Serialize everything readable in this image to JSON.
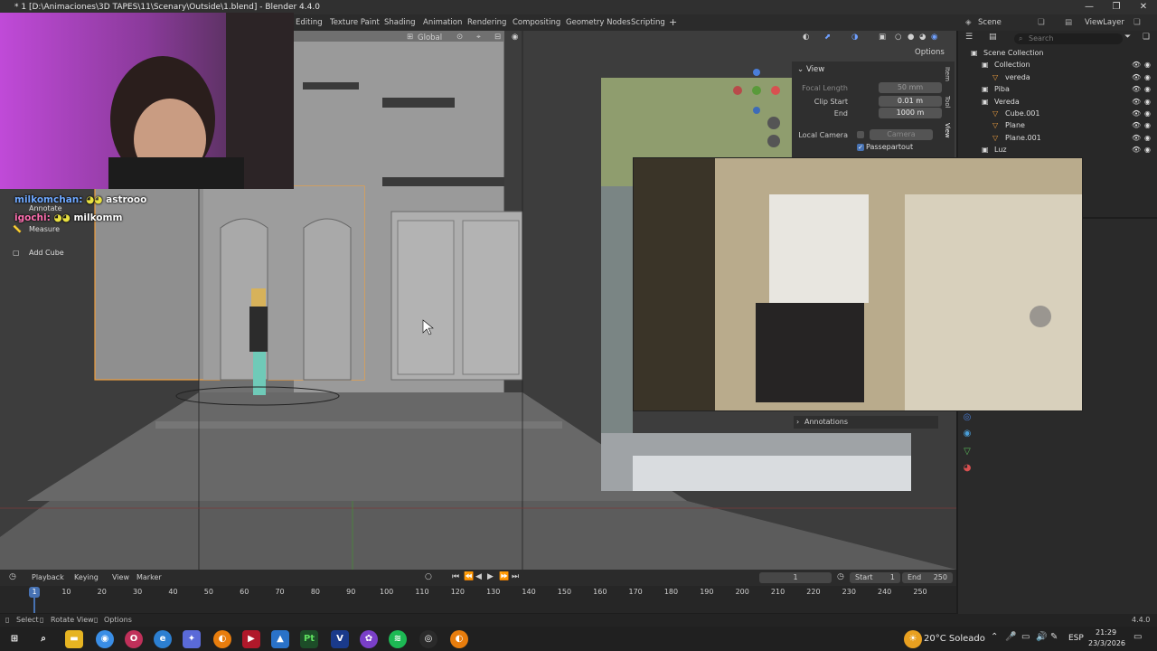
{
  "window": {
    "title": "* 1 [D:\\Animaciones\\3D TAPES\\11\\Scenary\\Outside\\1.blend] - Blender 4.4.0",
    "controls": [
      "minimize-icon",
      "maximize-icon",
      "close-icon"
    ]
  },
  "workspaces": [
    "Editing",
    "Texture Paint",
    "Shading",
    "Animation",
    "Rendering",
    "Compositing",
    "Geometry Nodes",
    "Scripting"
  ],
  "scene": {
    "name": "Scene",
    "view_layer": "ViewLayer"
  },
  "viewport_header": {
    "orientation": "Global",
    "options_label": "Options"
  },
  "side_tools": [
    "Annotate",
    "Measure",
    "Add Cube"
  ],
  "n_panel": {
    "section": "View",
    "focal_length_label": "Focal Length",
    "focal_length_value": "50 mm",
    "clip_start_label": "Clip Start",
    "clip_start_value": "0.01 m",
    "end_label": "End",
    "end_value": "1000 m",
    "local_camera_label": "Local Camera",
    "camera_placeholder": "Camera",
    "passepartout_label": "Passepartout",
    "tabs": [
      "Item",
      "Tool",
      "View"
    ],
    "annotations_label": "Annotations"
  },
  "outliner": {
    "search_placeholder": "Search",
    "items": [
      {
        "name": "Scene Collection",
        "indent": 0,
        "kind": "scene"
      },
      {
        "name": "Collection",
        "indent": 1,
        "kind": "collection"
      },
      {
        "name": "vereda",
        "indent": 2,
        "kind": "object"
      },
      {
        "name": "Piba",
        "indent": 1,
        "kind": "collection"
      },
      {
        "name": "Vereda",
        "indent": 1,
        "kind": "collection"
      },
      {
        "name": "Cube.001",
        "indent": 2,
        "kind": "object"
      },
      {
        "name": "Plane",
        "indent": 2,
        "kind": "object"
      },
      {
        "name": "Plane.001",
        "indent": 2,
        "kind": "object"
      },
      {
        "name": "Luz",
        "indent": 1,
        "kind": "collection"
      }
    ]
  },
  "timeline": {
    "menus": [
      "Playback",
      "Keying",
      "View",
      "Marker"
    ],
    "current_frame": "1",
    "start_label": "Start",
    "start_value": "1",
    "end_label": "End",
    "end_value": "250",
    "ticks": [
      "10",
      "20",
      "30",
      "40",
      "50",
      "60",
      "70",
      "80",
      "90",
      "100",
      "110",
      "120",
      "130",
      "140",
      "150",
      "160",
      "170",
      "180",
      "190",
      "200",
      "210",
      "220",
      "230",
      "240",
      "250"
    ],
    "playhead": "1"
  },
  "status_bar": {
    "select": "Select",
    "rotate": "Rotate View",
    "options": "Options",
    "version": "4.4.0"
  },
  "chat": [
    {
      "user": "milkomchan:",
      "message": "astrooo",
      "user_color": "#6fa8ff"
    },
    {
      "user": "igochi:",
      "message": "milkomm",
      "user_color": "#ff6fb0"
    }
  ],
  "taskbar": {
    "weather": "20°C  Soleado",
    "lang": "ESP",
    "time": "21:29",
    "date": "23/3/2026"
  },
  "colors": {
    "accent": "#4772b3",
    "selection_orange": "#f0a040",
    "viewport_bg": "#3d3d3d"
  }
}
